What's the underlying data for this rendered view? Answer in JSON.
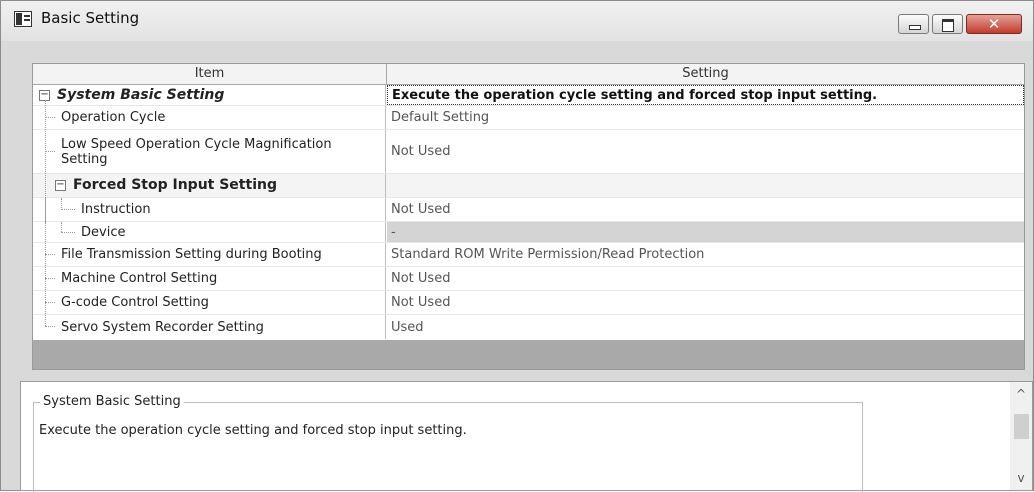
{
  "window": {
    "title": "Basic Setting",
    "controls": {
      "minimize": "─",
      "maximize": "▭",
      "close": "✕"
    }
  },
  "grid": {
    "headers": {
      "item": "Item",
      "setting": "Setting"
    },
    "rows": [
      {
        "item": "System Basic Setting",
        "setting": "Execute the operation cycle setting and forced stop input setting."
      },
      {
        "item": "Operation Cycle",
        "setting": "Default Setting"
      },
      {
        "item": "Low Speed Operation Cycle Magnification Setting",
        "setting": "Not Used"
      },
      {
        "item": "Forced Stop Input Setting",
        "setting": ""
      },
      {
        "item": "Instruction",
        "setting": "Not Used"
      },
      {
        "item": "Device",
        "setting": "-"
      },
      {
        "item": "File Transmission Setting during Booting",
        "setting": "Standard ROM Write Permission/Read Protection"
      },
      {
        "item": "Machine Control Setting",
        "setting": "Not Used"
      },
      {
        "item": "G-code Control Setting",
        "setting": "Not Used"
      },
      {
        "item": "Servo System Recorder Setting",
        "setting": "Used"
      }
    ],
    "toggles": {
      "expanded": "−"
    }
  },
  "description": {
    "title": "System Basic Setting",
    "text": "Execute the operation cycle setting and forced stop input setting."
  },
  "scrollbar": {
    "up": "^",
    "down": "v"
  },
  "colors": {
    "background": "#d9d9d9",
    "close_button": "#c23b2c",
    "footer_band": "#a9a9a9",
    "grey_cell": "#d4d4d4"
  }
}
